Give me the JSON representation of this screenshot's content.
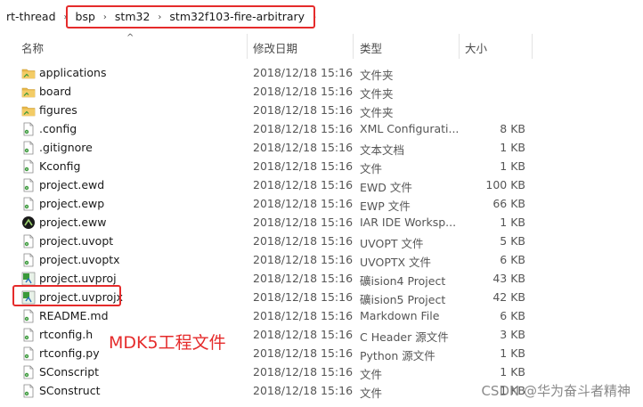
{
  "breadcrumb": {
    "items": [
      "rt-thread",
      "bsp",
      "stm32",
      "stm32f103-fire-arbitrary"
    ],
    "separator": "›"
  },
  "columns": {
    "name": "名称",
    "modified": "修改日期",
    "type": "类型",
    "size": "大小"
  },
  "files": [
    {
      "name": "applications",
      "modified": "2018/12/18 15:16",
      "type": "文件夹",
      "size": "",
      "icon": "folder-icon"
    },
    {
      "name": "board",
      "modified": "2018/12/18 15:16",
      "type": "文件夹",
      "size": "",
      "icon": "folder-icon"
    },
    {
      "name": "figures",
      "modified": "2018/12/18 15:16",
      "type": "文件夹",
      "size": "",
      "icon": "folder-icon"
    },
    {
      "name": ".config",
      "modified": "2018/12/18 15:16",
      "type": "XML Configurati...",
      "size": "8 KB",
      "icon": "xml-file-icon"
    },
    {
      "name": ".gitignore",
      "modified": "2018/12/18 15:16",
      "type": "文本文档",
      "size": "1 KB",
      "icon": "text-file-icon"
    },
    {
      "name": "Kconfig",
      "modified": "2018/12/18 15:16",
      "type": "文件",
      "size": "1 KB",
      "icon": "file-icon"
    },
    {
      "name": "project.ewd",
      "modified": "2018/12/18 15:16",
      "type": "EWD 文件",
      "size": "100 KB",
      "icon": "file-icon"
    },
    {
      "name": "project.ewp",
      "modified": "2018/12/18 15:16",
      "type": "EWP 文件",
      "size": "66 KB",
      "icon": "file-icon"
    },
    {
      "name": "project.eww",
      "modified": "2018/12/18 15:16",
      "type": "IAR IDE Worksp...",
      "size": "1 KB",
      "icon": "iar-workspace-icon"
    },
    {
      "name": "project.uvopt",
      "modified": "2018/12/18 15:16",
      "type": "UVOPT 文件",
      "size": "5 KB",
      "icon": "file-icon"
    },
    {
      "name": "project.uvoptx",
      "modified": "2018/12/18 15:16",
      "type": "UVOPTX 文件",
      "size": "6 KB",
      "icon": "file-icon"
    },
    {
      "name": "project.uvproj",
      "modified": "2018/12/18 15:16",
      "type": "礦ision4 Project",
      "size": "43 KB",
      "icon": "keil-project-icon"
    },
    {
      "name": "project.uvprojx",
      "modified": "2018/12/18 15:16",
      "type": "礦ision5 Project",
      "size": "42 KB",
      "icon": "keil-project-icon"
    },
    {
      "name": "README.md",
      "modified": "2018/12/18 15:16",
      "type": "Markdown File",
      "size": "6 KB",
      "icon": "file-icon"
    },
    {
      "name": "rtconfig.h",
      "modified": "2018/12/18 15:16",
      "type": "C Header 源文件",
      "size": "3 KB",
      "icon": "c-header-icon"
    },
    {
      "name": "rtconfig.py",
      "modified": "2018/12/18 15:16",
      "type": "Python 源文件",
      "size": "1 KB",
      "icon": "python-file-icon"
    },
    {
      "name": "SConscript",
      "modified": "2018/12/18 15:16",
      "type": "文件",
      "size": "1 KB",
      "icon": "file-icon"
    },
    {
      "name": "SConstruct",
      "modified": "2018/12/18 15:16",
      "type": "文件",
      "size": "1 KB",
      "icon": "file-icon"
    }
  ],
  "annotation": "MDK5工程文件",
  "watermark": "CSDN @华为奋斗者精神",
  "colors": {
    "highlight": "#e52b2b",
    "folder": "#e8b84a",
    "keil_green": "#3a9a3a"
  }
}
